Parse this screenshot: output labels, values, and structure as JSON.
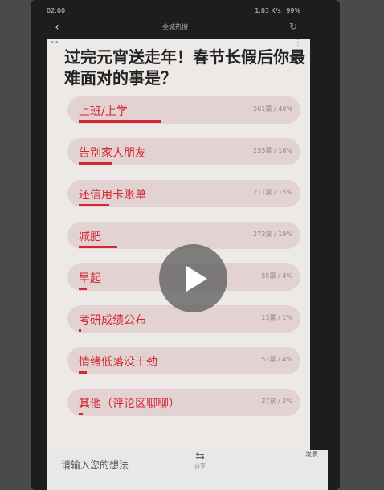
{
  "status_bar": {
    "time": "02:00",
    "network": "1.03 K/s",
    "battery": "99%"
  },
  "header": {
    "back_icon": "chevron-left-icon",
    "title": "全城热搜",
    "refresh_icon": "refresh-icon"
  },
  "poll": {
    "question": "过完元宵送走年！春节长假后你最难面对的事是？",
    "options": [
      {
        "label": "上班/上学",
        "stat": "561票 / 40%",
        "percent": 40
      },
      {
        "label": "告别家人朋友",
        "stat": "235票 / 16%",
        "percent": 16
      },
      {
        "label": "还信用卡账单",
        "stat": "211票 / 15%",
        "percent": 15
      },
      {
        "label": "减肥",
        "stat": "272票 / 19%",
        "percent": 19
      },
      {
        "label": "早起",
        "stat": "55票 / 4%",
        "percent": 4
      },
      {
        "label": "考研成绩公布",
        "stat": "13票 / 1%",
        "percent": 1
      },
      {
        "label": "情绪低落没干劲",
        "stat": "51票 / 4%",
        "percent": 4
      },
      {
        "label": "其他（评论区聊聊）",
        "stat": "27票 / 2%",
        "percent": 2
      }
    ]
  },
  "bottom_bar": {
    "comment_placeholder": "请输入您的想法",
    "share_label": "分享",
    "send_label": "发表"
  },
  "colors": {
    "accent": "#d42632",
    "option_bg": "#e3d2d2",
    "screen_bg": "#ece9e7"
  }
}
